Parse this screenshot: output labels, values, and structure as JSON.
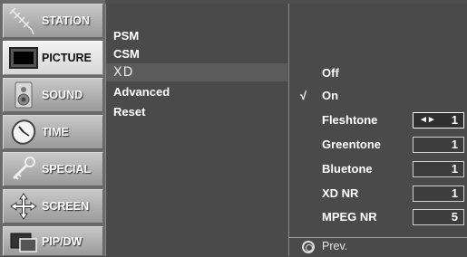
{
  "sidebar": {
    "tabs": [
      {
        "label": "STATION",
        "icon": "antenna-icon"
      },
      {
        "label": "PICTURE",
        "icon": "tv-screen-icon"
      },
      {
        "label": "SOUND",
        "icon": "speaker-icon"
      },
      {
        "label": "TIME",
        "icon": "clock-icon"
      },
      {
        "label": "SPECIAL",
        "icon": "key-icon"
      },
      {
        "label": "SCREEN",
        "icon": "move-arrows-icon"
      },
      {
        "label": "PIP/DW",
        "icon": "pip-windows-icon"
      }
    ],
    "active": "PICTURE"
  },
  "menu": {
    "items": [
      "PSM",
      "CSM",
      "XD",
      "Advanced",
      "Reset"
    ],
    "selected": "XD"
  },
  "submenu": {
    "checkmark": "√",
    "modes": [
      {
        "label": "Off",
        "checked": false
      },
      {
        "label": "On",
        "checked": true
      }
    ],
    "settings": [
      {
        "label": "Fleshtone",
        "value": "1",
        "arrows": "◄►",
        "focused": true
      },
      {
        "label": "Greentone",
        "value": "1"
      },
      {
        "label": "Bluetone",
        "value": "1"
      },
      {
        "label": "XD NR",
        "value": "1"
      },
      {
        "label": "MPEG NR",
        "value": "5"
      }
    ],
    "footer_label": "Prev."
  }
}
